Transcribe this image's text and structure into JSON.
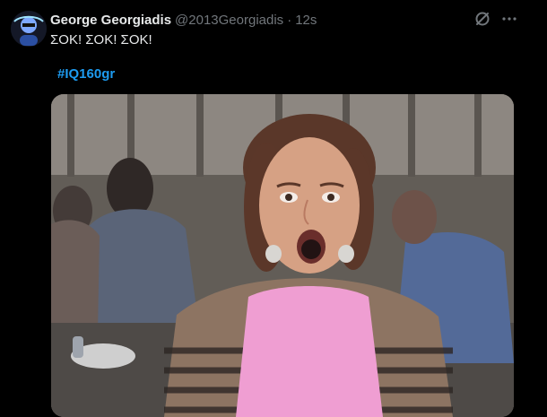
{
  "tweet": {
    "author_name": "George Georgiadis",
    "handle": "@2013Georgiadis",
    "separator": "·",
    "time": "12s",
    "text": "ΣΟΚ! ΣΟΚ! ΣΟΚ!",
    "hashtag": "#IQ160gr"
  },
  "icons": {
    "avatar": "avatar",
    "grok": "grok-icon",
    "more": "more-icon"
  },
  "colors": {
    "background": "#000000",
    "text": "#e7e9ea",
    "muted": "#71767b",
    "link": "#1d9bf0"
  }
}
